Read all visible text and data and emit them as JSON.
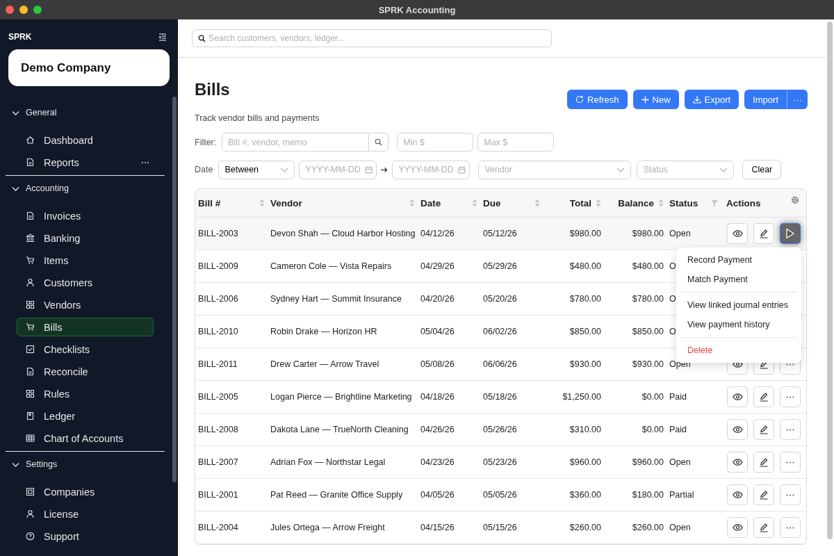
{
  "window": {
    "title": "SPRK Accounting"
  },
  "sidebar": {
    "brand": "SPRK",
    "company": "Demo Company",
    "sections": [
      {
        "title": "General",
        "expanded": true,
        "items": [
          {
            "label": "Dashboard",
            "selected": false,
            "more": false
          },
          {
            "label": "Reports",
            "selected": false,
            "more": true
          }
        ]
      },
      {
        "title": "Accounting",
        "expanded": true,
        "items": [
          {
            "label": "Invoices",
            "selected": false,
            "more": false
          },
          {
            "label": "Banking",
            "selected": false,
            "more": false
          },
          {
            "label": "Items",
            "selected": false,
            "more": false
          },
          {
            "label": "Customers",
            "selected": false,
            "more": false
          },
          {
            "label": "Vendors",
            "selected": false,
            "more": false
          },
          {
            "label": "Bills",
            "selected": true,
            "more": false
          },
          {
            "label": "Checklists",
            "selected": false,
            "more": false
          },
          {
            "label": "Reconcile",
            "selected": false,
            "more": false
          },
          {
            "label": "Rules",
            "selected": false,
            "more": false
          },
          {
            "label": "Ledger",
            "selected": false,
            "more": false
          },
          {
            "label": "Chart of Accounts",
            "selected": false,
            "more": false
          }
        ]
      },
      {
        "title": "Settings",
        "expanded": true,
        "items": [
          {
            "label": "Companies",
            "selected": false,
            "more": false
          },
          {
            "label": "License",
            "selected": false,
            "more": false
          },
          {
            "label": "Support",
            "selected": false,
            "more": false
          }
        ]
      }
    ]
  },
  "search": {
    "placeholder": "Search customers, vendors, ledger..."
  },
  "page": {
    "title": "Bills",
    "subtitle": "Track vendor bills and payments"
  },
  "toolbar": {
    "buttons": [
      "Refresh",
      "New",
      "Export",
      "Import"
    ],
    "more": "···"
  },
  "filters": {
    "filter_label": "Filter:",
    "query_placeholder": "Bill #, vendor, memo",
    "min_placeholder": "Min $",
    "max_placeholder": "Max $",
    "date_label": "Date",
    "date_mode": "Between",
    "from_placeholder": "YYYY-MM-DD",
    "to_placeholder": "YYYY-MM-DD",
    "vendor_placeholder": "Vendor",
    "status_placeholder": "Status",
    "clear": "Clear"
  },
  "table": {
    "columns": [
      {
        "label": "Bill #",
        "sortable": true,
        "filterable": false
      },
      {
        "label": "Vendor",
        "sortable": true,
        "filterable": false
      },
      {
        "label": "Date",
        "sortable": true,
        "filterable": false
      },
      {
        "label": "Due",
        "sortable": true,
        "filterable": false
      },
      {
        "label": "Total",
        "sortable": true,
        "filterable": false
      },
      {
        "label": "Balance",
        "sortable": true,
        "filterable": false
      },
      {
        "label": "Status",
        "sortable": false,
        "filterable": true
      },
      {
        "label": "Actions",
        "sortable": false,
        "filterable": false
      }
    ],
    "rows": [
      {
        "cells": [
          "BILL-2003",
          "Devon Shah — Cloud Harbor Hosting",
          "04/12/26",
          "05/12/26",
          "$980.00",
          "$980.00",
          "Open"
        ],
        "menu": {
          "groups": [
            [
              {
                "label": "Record Payment",
                "kind": "normal"
              },
              {
                "label": "Match Payment",
                "kind": "normal"
              }
            ],
            [
              {
                "label": "View linked journal entries",
                "kind": "normal"
              },
              {
                "label": "View payment history",
                "kind": "normal"
              }
            ],
            [
              {
                "label": "Delete",
                "kind": "danger"
              }
            ]
          ]
        }
      },
      {
        "cells": [
          "BILL-2009",
          "Cameron Cole — Vista Repairs",
          "04/29/26",
          "05/29/26",
          "$480.00",
          "$480.00",
          "O"
        ]
      },
      {
        "cells": [
          "BILL-2006",
          "Sydney Hart — Summit Insurance",
          "04/20/26",
          "05/20/26",
          "$780.00",
          "$780.00",
          "O"
        ]
      },
      {
        "cells": [
          "BILL-2010",
          "Robin Drake — Horizon HR",
          "05/04/26",
          "06/02/26",
          "$850.00",
          "$850.00",
          "O"
        ]
      },
      {
        "cells": [
          "BILL-2011",
          "Drew Carter — Arrow Travel",
          "05/08/26",
          "06/06/26",
          "$930.00",
          "$930.00",
          "Open"
        ]
      },
      {
        "cells": [
          "BILL-2005",
          "Logan Pierce — Brightline Marketing",
          "04/18/26",
          "05/18/26",
          "$1,250.00",
          "$0.00",
          "Paid"
        ]
      },
      {
        "cells": [
          "BILL-2008",
          "Dakota Lane — TrueNorth Cleaning",
          "04/26/26",
          "05/26/26",
          "$310.00",
          "$0.00",
          "Paid"
        ]
      },
      {
        "cells": [
          "BILL-2007",
          "Adrian Fox — Northstar Legal",
          "04/23/26",
          "05/23/26",
          "$960.00",
          "$960.00",
          "Open"
        ]
      },
      {
        "cells": [
          "BILL-2001",
          "Pat Reed — Granite Office Supply",
          "04/05/26",
          "05/05/26",
          "$360.00",
          "$180.00",
          "Partial"
        ]
      },
      {
        "cells": [
          "BILL-2004",
          "Jules Ortega — Arrow Freight",
          "04/15/26",
          "05/15/26",
          "$260.00",
          "$260.00",
          "Open"
        ]
      }
    ]
  }
}
